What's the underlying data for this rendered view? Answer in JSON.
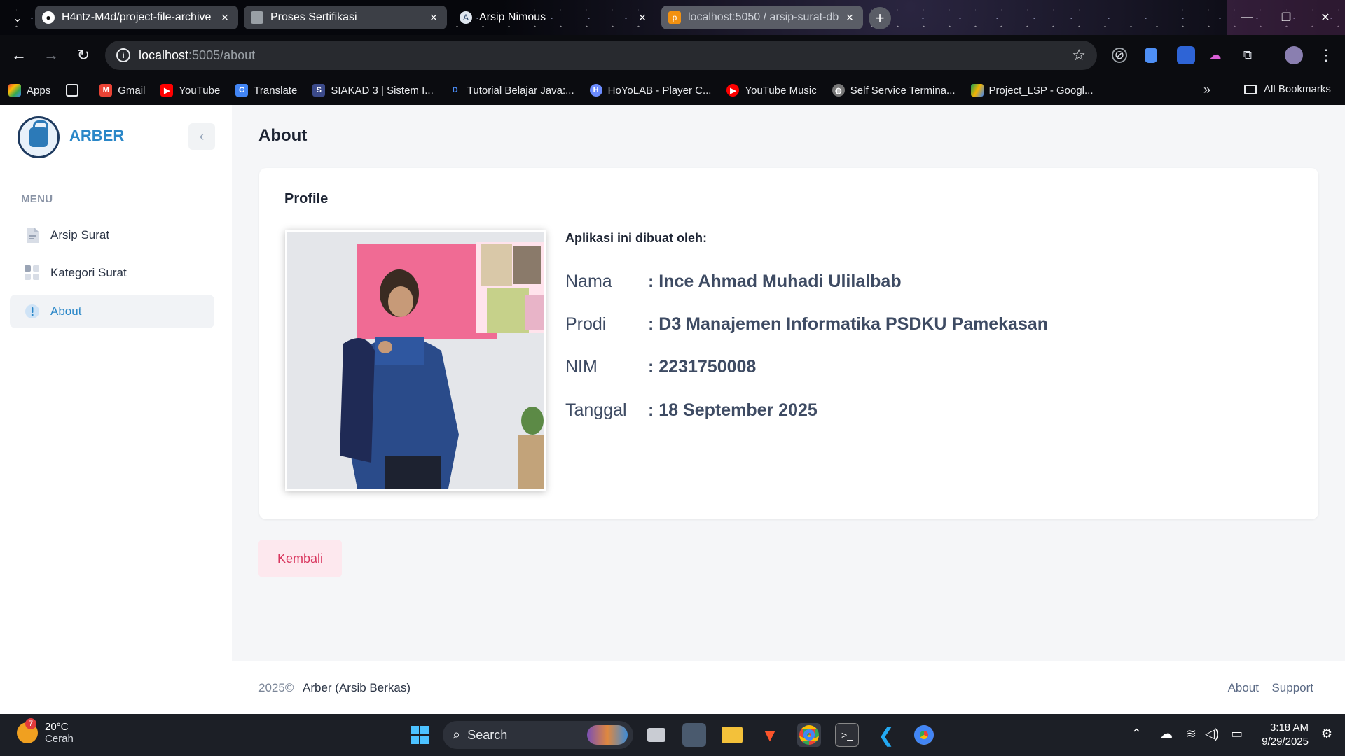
{
  "browser": {
    "tabs": [
      {
        "label": "H4ntz-M4d/project-file-archive",
        "icon": "github-icon"
      },
      {
        "label": "Proses Sertifikasi",
        "icon": "form-icon"
      },
      {
        "label": "Arsip Nimous",
        "icon": "arsip-icon"
      },
      {
        "label": "localhost:5050 / arsip-surat-db",
        "icon": "phpmyadmin-icon"
      }
    ],
    "url_host": "localhost",
    "url_path": ":5005/about",
    "bookmarks": [
      {
        "label": "Apps",
        "color": "#ea4335"
      },
      {
        "label": "Gmail",
        "color": "#ea4335"
      },
      {
        "label": "YouTube",
        "color": "#ff0000"
      },
      {
        "label": "Translate",
        "color": "#4285f4"
      },
      {
        "label": "SIAKAD 3 | Sistem I...",
        "color": "#3b4a8a"
      },
      {
        "label": "Tutorial Belajar Java:...",
        "color": "#1a73e8"
      },
      {
        "label": "HoYoLAB - Player C...",
        "color": "#6c8cff"
      },
      {
        "label": "YouTube Music",
        "color": "#ff0000"
      },
      {
        "label": "Self Service Termina...",
        "color": "#777777"
      },
      {
        "label": "Project_LSP - Googl...",
        "color": "#0f9d58"
      }
    ],
    "all_bookmarks": "All Bookmarks"
  },
  "sidebar": {
    "brand": "ARBER",
    "menu_heading": "MENU",
    "items": [
      {
        "label": "Arsip Surat",
        "icon": "document-icon"
      },
      {
        "label": "Kategori Surat",
        "icon": "grid-icon"
      },
      {
        "label": "About",
        "icon": "info-icon",
        "active": true
      }
    ]
  },
  "main": {
    "title": "About",
    "card_title": "Profile",
    "made_by": "Aplikasi ini dibuat oleh:",
    "details": [
      {
        "key": "Nama",
        "value": ": Ince Ahmad Muhadi Ulilalbab"
      },
      {
        "key": "Prodi",
        "value": ": D3 Manajemen Informatika PSDKU Pamekasan"
      },
      {
        "key": "NIM",
        "value": ": 2231750008"
      },
      {
        "key": "Tanggal",
        "value": ": 18 September 2025"
      }
    ],
    "back_button": "Kembali"
  },
  "footer": {
    "year": "2025©",
    "name": "Arber (Arsib Berkas)",
    "links": [
      "About",
      "Support"
    ]
  },
  "taskbar": {
    "temperature": "20°C",
    "condition": "Cerah",
    "weather_badge": "7",
    "search": "Search",
    "time": "3:18 AM",
    "date": "9/29/2025"
  },
  "colors": {
    "accent": "#2a87c8",
    "danger_text": "#d9365e",
    "danger_bg": "#fde8ee"
  }
}
